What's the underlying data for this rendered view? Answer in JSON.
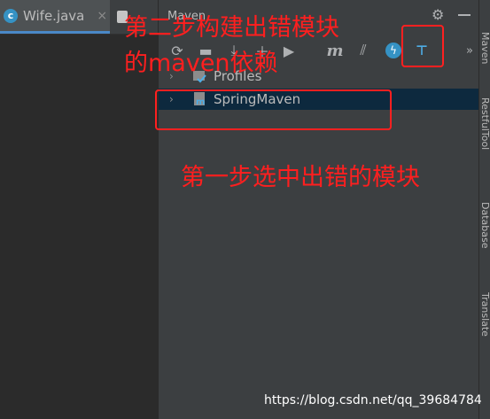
{
  "editor": {
    "tabs": [
      {
        "label": "Wife.java",
        "close": "×"
      }
    ]
  },
  "maven": {
    "title": "Maven",
    "tree": [
      {
        "label": "Profiles"
      },
      {
        "label": "SpringMaven"
      }
    ]
  },
  "side_stripe": [
    {
      "label": "Maven"
    },
    {
      "label": "RestfulTool"
    },
    {
      "label": "Database"
    },
    {
      "label": "Translate"
    }
  ],
  "annotations": {
    "step2": "第二步构建出错模块",
    "step2_line2": "的maven依赖",
    "step1": "第一步选中出错的模块"
  },
  "watermark": "https://blog.csdn.net/qq_39684784",
  "colors": {
    "annotation_red": "#ff1f1f",
    "selection": "#0d293e",
    "accent": "#4a88c7"
  }
}
